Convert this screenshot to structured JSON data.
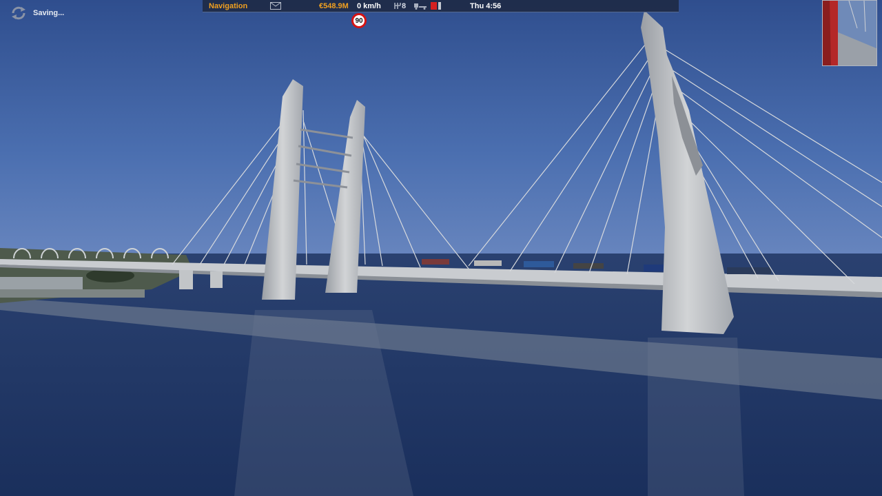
{
  "status": {
    "saving_label": "Saving..."
  },
  "hud": {
    "navigation_label": "Navigation",
    "money": "€548.9M",
    "speed": "0 km/h",
    "gear": "8",
    "time": "Thu 4:56",
    "speed_limit": "90"
  },
  "icons": {
    "saving": "refresh-icon",
    "mail": "envelope-icon",
    "gear": "gearbox-icon",
    "truck": "truck-trailer-icon",
    "fuel": "fuel-icon"
  },
  "colors": {
    "accent": "#f0a020",
    "hud_bg": "#1e2a46",
    "limit_ring": "#d41414",
    "sky": "#3f64a8",
    "water": "#20386a"
  }
}
